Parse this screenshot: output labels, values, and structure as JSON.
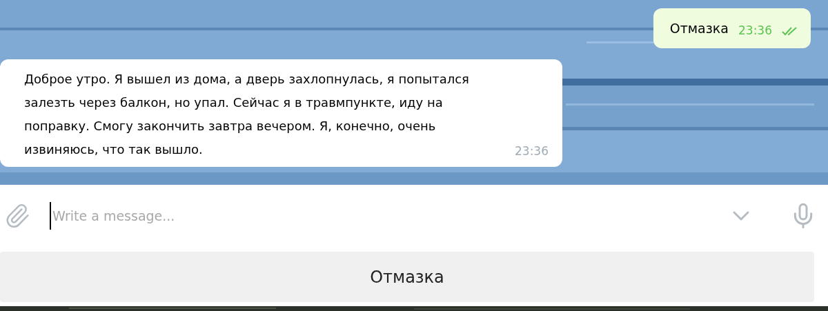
{
  "messages": [
    {
      "kind": "outgoing",
      "text": "Отмазка",
      "time": "23:36",
      "read": true
    },
    {
      "kind": "incoming",
      "text": "Доброе утро. Я вышел из дома, а дверь захлопнулась, я попытался залезть через балкон, но упал. Сейчас я в травмпункте, иду на поправку. Смогу закончить завтра вечером. Я, конечно, очень извиняюсь, что так вышло.",
      "time": "23:36"
    }
  ],
  "composer": {
    "placeholder": "Write a message..."
  },
  "keyboard": {
    "buttons": [
      "Отмазка"
    ]
  }
}
